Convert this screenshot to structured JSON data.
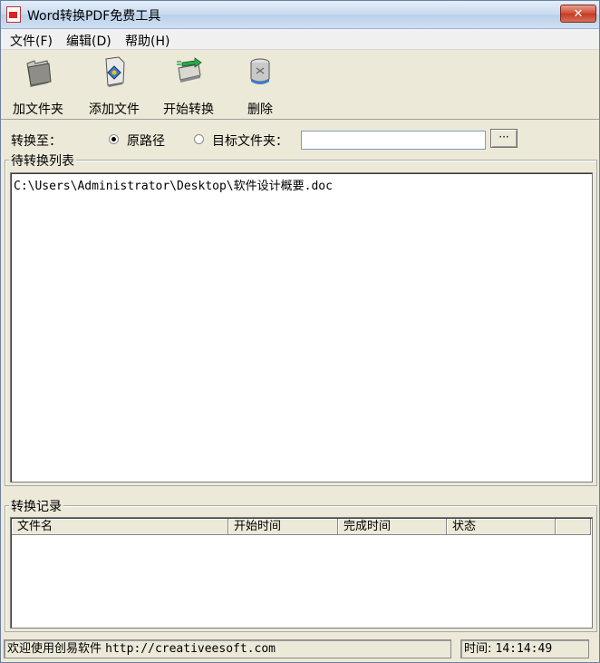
{
  "window": {
    "title": "Word转换PDF免费工具",
    "close_label": "✕"
  },
  "menu": {
    "items": [
      "文件(F)",
      "编辑(D)",
      "帮助(H)"
    ]
  },
  "toolbar": {
    "buttons": [
      {
        "label": "加文件夹",
        "icon": "folder-icon"
      },
      {
        "label": "添加文件",
        "icon": "add-file-icon"
      },
      {
        "label": "开始转换",
        "icon": "convert-icon"
      },
      {
        "label": "删除",
        "icon": "delete-icon"
      }
    ]
  },
  "destination": {
    "label": "转换至：",
    "options": [
      {
        "label": "原路径",
        "selected": true
      },
      {
        "label": "目标文件夹：",
        "selected": false
      }
    ],
    "target_value": "",
    "browse_label": "···"
  },
  "pending": {
    "title": "待转换列表",
    "files": [
      "C:\\Users\\Administrator\\Desktop\\软件设计概要.doc"
    ]
  },
  "records": {
    "title": "转换记录",
    "columns": [
      "文件名",
      "开始时间",
      "完成时间",
      "状态",
      ""
    ]
  },
  "status": {
    "welcome": "欢迎使用创易软件",
    "url": "http://creativeesoft.com",
    "time_label": "时间:",
    "time_value": "14:14:49"
  }
}
